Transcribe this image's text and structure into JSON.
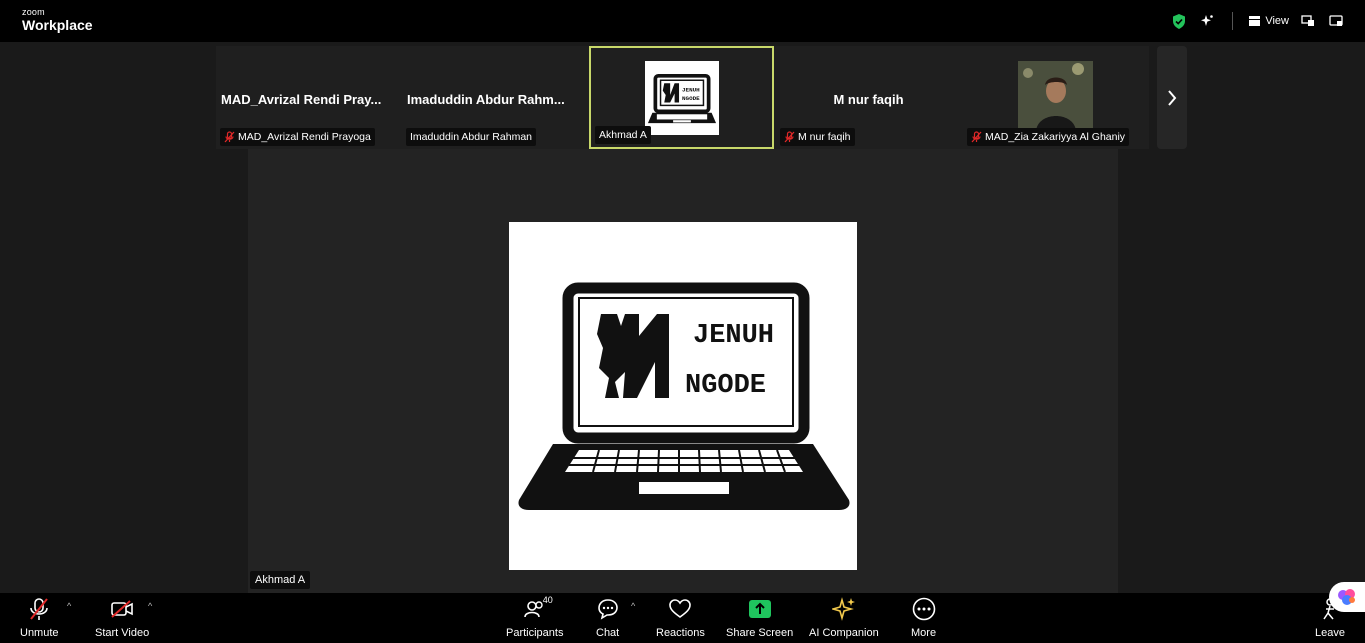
{
  "app": {
    "brand_small": "zoom",
    "brand_big": "Workplace"
  },
  "topbar": {
    "view_label": "View"
  },
  "gallery": {
    "tiles": [
      {
        "display_name": "MAD_Avrizal Rendi Pray...",
        "tag_name": "MAD_Avrizal Rendi Prayoga",
        "muted": true
      },
      {
        "display_name": "Imaduddin Abdur Rahm...",
        "tag_name": "Imaduddin Abdur Rahman",
        "muted": false
      },
      {
        "display_name": "",
        "tag_name": "Akhmad A",
        "muted": false,
        "logo_text_1": "JENUH",
        "logo_text_2": "NGODE"
      },
      {
        "display_name": "M nur faqih",
        "tag_name": "M nur faqih",
        "muted": true
      },
      {
        "display_name": "",
        "tag_name": "MAD_Zia Zakariyya Al Ghaniy",
        "muted": true
      }
    ]
  },
  "stage": {
    "speaker_tag": "Akhmad A",
    "logo_text_1": "JENUH",
    "logo_text_2": "NGODE"
  },
  "toolbar": {
    "unmute": "Unmute",
    "start_video": "Start Video",
    "participants": "Participants",
    "participants_count": "40",
    "chat": "Chat",
    "reactions": "Reactions",
    "share_screen": "Share Screen",
    "ai_companion": "AI Companion",
    "more": "More",
    "leave": "Leave"
  },
  "colors": {
    "active_border": "#c8d86a",
    "muted_red": "#e02828",
    "share_green": "#1fc55e",
    "ai_gold": "#f2c94c",
    "shield_green": "#23c35b"
  }
}
